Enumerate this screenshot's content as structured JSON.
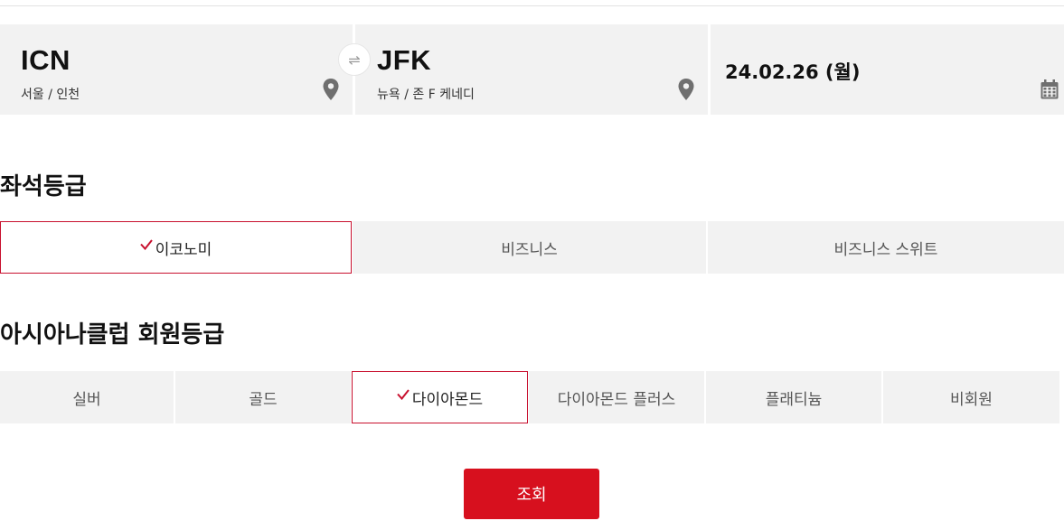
{
  "route": {
    "departure": {
      "code": "ICN",
      "city": "서울 / 인천"
    },
    "arrival": {
      "code": "JFK",
      "city": "뉴욕 / 존 F 케네디"
    },
    "date": "24.02.26 (월)",
    "swap_icon": "⇌"
  },
  "seat_class": {
    "title": "좌석등급",
    "options": [
      "이코노미",
      "비즈니스",
      "비즈니스 스위트"
    ],
    "selected_index": 0
  },
  "membership": {
    "title": "아시아나클럽 회원등급",
    "options": [
      "실버",
      "골드",
      "다이아몬드",
      "다이아몬드 플러스",
      "플래티늄",
      "비회원"
    ],
    "selected_index": 2
  },
  "search_button": "조회",
  "colors": {
    "accent": "#c8102e",
    "button": "#d7101e",
    "panel": "#f2f2f2"
  },
  "icons": [
    "map-pin-icon",
    "swap-icon",
    "calendar-icon",
    "check-icon"
  ]
}
